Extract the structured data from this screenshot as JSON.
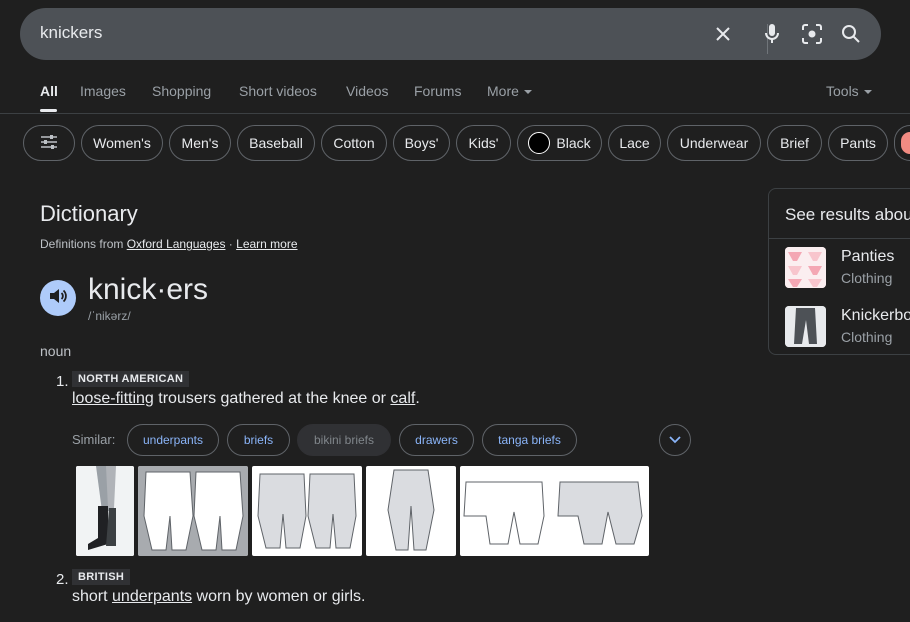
{
  "search": {
    "query": "knickers",
    "icons": [
      "close-icon",
      "microphone-icon",
      "lens-icon",
      "search-icon"
    ]
  },
  "tabs": [
    {
      "label": "All",
      "active": true
    },
    {
      "label": "Images"
    },
    {
      "label": "Shopping"
    },
    {
      "label": "Short videos"
    },
    {
      "label": "Videos"
    },
    {
      "label": "Forums"
    },
    {
      "label": "More"
    }
  ],
  "tools_label": "Tools",
  "chips": [
    "Women's",
    "Men's",
    "Baseball",
    "Cotton",
    "Boys'",
    "Kids'",
    "Black",
    "Lace",
    "Underwear",
    "Brief",
    "Pants"
  ],
  "dictionary": {
    "title": "Dictionary",
    "from_prefix": "Definitions from",
    "source": "Oxford Languages",
    "sep": " · ",
    "learn_more": "Learn more",
    "word": "knick·ers",
    "phonetic": "/ˈnikərz/",
    "part_of_speech": "noun",
    "senses": [
      {
        "number": "1.",
        "label": "NORTH AMERICAN",
        "def_link1": "loose-fitting",
        "def_mid": " trousers gathered at the knee or ",
        "def_link2": "calf",
        "def_end": "."
      },
      {
        "number": "2.",
        "label": "BRITISH",
        "def_start": "short ",
        "def_link1": "underpants",
        "def_end": " worn by women or girls."
      }
    ],
    "similar_label": "Similar:",
    "similar": [
      "underpants",
      "briefs",
      "bikini briefs",
      "drawers",
      "tanga briefs"
    ]
  },
  "side_panel": {
    "title": "See results about",
    "items": [
      {
        "name": "Panties",
        "category": "Clothing"
      },
      {
        "name": "Knickerbockers",
        "category": "Clothing"
      }
    ]
  },
  "colors": {
    "background": "#1f1f1f",
    "searchbar": "#4d5156",
    "link_blue": "#8ab4f8",
    "speaker_bg": "#aecbfa"
  }
}
